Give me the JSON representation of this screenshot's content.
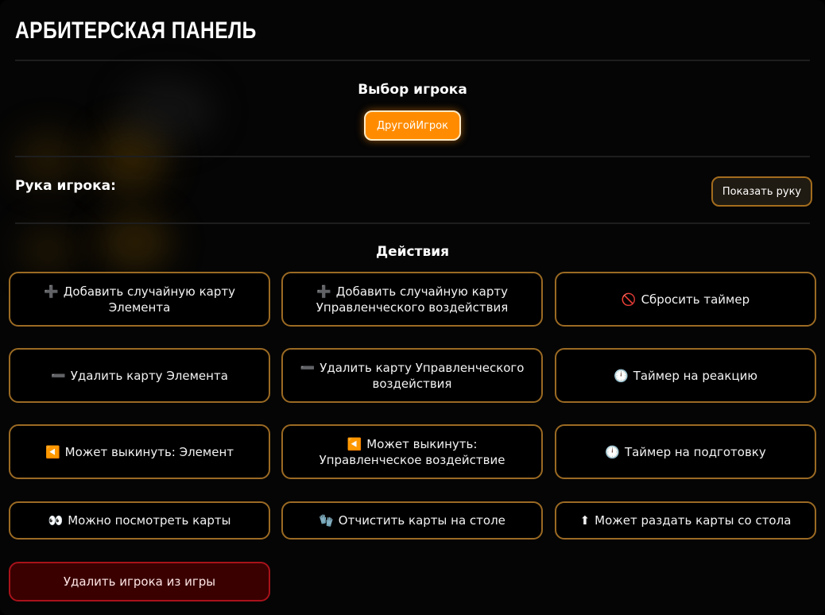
{
  "header": {
    "title": "АРБИТЕРСКАЯ ПАНЕЛЬ"
  },
  "player_selection": {
    "heading": "Выбор игрока",
    "selected_player": "ДругойИгрок"
  },
  "hand": {
    "label": "Рука игрока:",
    "show_button": "Показать руку"
  },
  "actions": {
    "heading": "Действия",
    "buttons": [
      {
        "icon": "plus-icon",
        "glyph": "➕",
        "label": "Добавить случайную карту Элемента"
      },
      {
        "icon": "plus-icon",
        "glyph": "➕",
        "label": "Добавить случайную карту Управленческого воздействия"
      },
      {
        "icon": "no-entry-icon",
        "glyph": "🚫",
        "label": "Сбросить таймер"
      },
      {
        "icon": "minus-icon",
        "glyph": "➖",
        "label": "Удалить карту Элемента"
      },
      {
        "icon": "minus-icon",
        "glyph": "➖",
        "label": "Удалить карту Управленческого воздействия"
      },
      {
        "icon": "clock-icon",
        "glyph": "🕛",
        "label": "Таймер на реакцию"
      },
      {
        "icon": "reverse-icon",
        "glyph": "◀️",
        "label": "Может выкинуть: Элемент"
      },
      {
        "icon": "reverse-icon",
        "glyph": "◀️",
        "label": "Может выкинуть: Управленческое воздействие"
      },
      {
        "icon": "clock-icon",
        "glyph": "🕛",
        "label": "Таймер на подготовку"
      },
      {
        "icon": "eyes-icon",
        "glyph": "👀",
        "label": "Можно посмотреть карты"
      },
      {
        "icon": "gloves-icon",
        "glyph": "🧤",
        "label": "Отчистить карты на столе"
      },
      {
        "icon": "up-arrow-icon",
        "glyph": "⬆",
        "label": "Может раздать карты со стола"
      }
    ],
    "remove_player": "Удалить игрока из игры"
  },
  "colors": {
    "accent": "#ff8c00",
    "button_border": "#9b6a23",
    "danger_bg": "#3a0000",
    "danger_border": "#a8121a",
    "background": "#050505"
  }
}
